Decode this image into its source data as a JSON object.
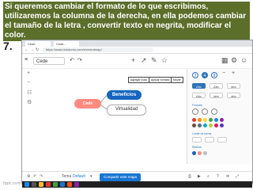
{
  "caption": "Si queremos cambiar el formato de lo que escribimos, utilizaremos la columna de la derecha, en ella podemos cambiar el tamaño de la letra , convertir texto en negrita, modificar el color.",
  "step_number": "7.",
  "browser": {
    "tabs": [
      "Cede",
      "Cede - Mindomo"
    ],
    "address": "https://www.mindomo.com/es/mindmap/"
  },
  "toolbar": {
    "doc_name": "Cede",
    "callouts": [
      "Agregar nodo",
      "Aplicar formato",
      "Mover"
    ]
  },
  "nodes": {
    "central": "Cede",
    "topic1": "Beneficios",
    "topic2": "Virtualidad"
  },
  "format_panel": {
    "font_size_values": [
      "2",
      "4",
      "8"
    ],
    "style_buttons": [
      "Abc",
      "Abc",
      "abc",
      "Abc",
      "abc",
      "abc"
    ],
    "section_labels": [
      "Formato",
      "Límite de forma",
      "Relleno"
    ],
    "swatch_colors": [
      "#e53935",
      "#fb8c00",
      "#fdd835",
      "#43a047",
      "#1e88e5",
      "#8e24aa",
      "#6d4c41",
      "#546e7a",
      "#00acc1",
      "#c0ca33",
      "#d81b60",
      "#5e35b1"
    ]
  },
  "bottom_bar": {
    "theme_label": "Tema",
    "theme_value": "Default",
    "share_button": "Compartir este mapa"
  },
  "watermark": "fppt.com"
}
